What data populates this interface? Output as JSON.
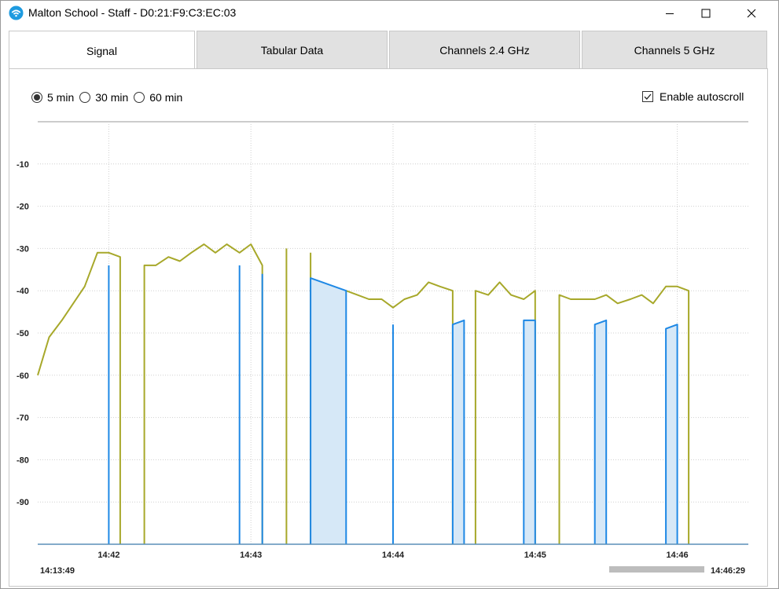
{
  "window": {
    "title": "Malton School - Staff - D0:21:F9:C3:EC:03",
    "icon": "wifi-app-icon",
    "controls": {
      "minimize": "minimize-icon",
      "maximize": "maximize-icon",
      "close": "close-icon"
    }
  },
  "tabs": [
    {
      "label": "Signal",
      "active": true
    },
    {
      "label": "Tabular Data",
      "active": false
    },
    {
      "label": "Channels 2.4 GHz",
      "active": false
    },
    {
      "label": "Channels 5 GHz",
      "active": false
    }
  ],
  "time_range": {
    "options": [
      "5 min",
      "30 min",
      "60 min"
    ],
    "selected": "5 min"
  },
  "autoscroll": {
    "label": "Enable autoscroll",
    "checked": true
  },
  "range": {
    "start": "14:13:49",
    "end": "14:46:29"
  },
  "colors": {
    "olive_series": "#a7a82a",
    "blue_series": "#1e88e5",
    "blue_fill": "#d6e8f7"
  },
  "chart_data": {
    "type": "line",
    "x_unit": "minutes past 14:00",
    "xlim": [
      41.5,
      46.5
    ],
    "ylim": [
      -100,
      0
    ],
    "yticks": [
      -10,
      -20,
      -30,
      -40,
      -50,
      -60,
      -70,
      -80,
      -90
    ],
    "ytick_labels": [
      "-10",
      "-20",
      "-30",
      "-40",
      "-50",
      "-60",
      "-70",
      "-80",
      "-90"
    ],
    "xticks": [
      42,
      43,
      44,
      45,
      46
    ],
    "xtick_labels": [
      "14:42",
      "14:43",
      "14:44",
      "14:45",
      "14:46"
    ],
    "grid": true,
    "series": [
      {
        "color": "#a7a82a",
        "filled": false,
        "segments": [
          [
            [
              41.5,
              -60
            ],
            [
              41.58,
              -51
            ],
            [
              41.67,
              -47
            ],
            [
              41.83,
              -39
            ],
            [
              41.92,
              -31
            ],
            [
              42.0,
              -31
            ],
            [
              42.08,
              -32
            ],
            [
              42.08,
              -100
            ]
          ],
          [
            [
              42.25,
              -100
            ],
            [
              42.25,
              -34
            ],
            [
              42.33,
              -34
            ],
            [
              42.42,
              -32
            ],
            [
              42.5,
              -33
            ],
            [
              42.58,
              -31
            ],
            [
              42.67,
              -29
            ],
            [
              42.75,
              -31
            ],
            [
              42.83,
              -29
            ],
            [
              42.92,
              -31
            ],
            [
              43.0,
              -29
            ],
            [
              43.08,
              -34
            ],
            [
              43.08,
              -100
            ]
          ],
          [
            [
              43.25,
              -100
            ],
            [
              43.25,
              -30
            ]
          ],
          [
            [
              43.42,
              -31
            ],
            [
              43.42,
              -100
            ]
          ],
          [
            [
              43.58,
              -100
            ],
            [
              43.58,
              -41
            ],
            [
              43.67,
              -40
            ],
            [
              43.75,
              -41
            ],
            [
              43.83,
              -42
            ],
            [
              43.92,
              -42
            ],
            [
              44.0,
              -44
            ],
            [
              44.08,
              -42
            ],
            [
              44.17,
              -41
            ],
            [
              44.25,
              -38
            ],
            [
              44.33,
              -39
            ],
            [
              44.42,
              -40
            ],
            [
              44.42,
              -100
            ]
          ],
          [
            [
              44.58,
              -100
            ],
            [
              44.58,
              -40
            ],
            [
              44.67,
              -41
            ],
            [
              44.75,
              -38
            ],
            [
              44.83,
              -41
            ],
            [
              44.92,
              -42
            ],
            [
              45.0,
              -40
            ],
            [
              45.0,
              -100
            ]
          ],
          [
            [
              45.17,
              -100
            ],
            [
              45.17,
              -41
            ],
            [
              45.25,
              -42
            ],
            [
              45.33,
              -42
            ],
            [
              45.42,
              -42
            ],
            [
              45.5,
              -41
            ],
            [
              45.58,
              -43
            ],
            [
              45.67,
              -42
            ],
            [
              45.75,
              -41
            ],
            [
              45.83,
              -43
            ],
            [
              45.92,
              -39
            ],
            [
              46.0,
              -39
            ],
            [
              46.08,
              -40
            ],
            [
              46.08,
              -100
            ]
          ]
        ]
      },
      {
        "color": "#1e88e5",
        "filled": true,
        "segments": [
          [
            [
              42.0,
              -34
            ],
            [
              42.0,
              -100
            ]
          ],
          [
            [
              42.92,
              -34
            ],
            [
              42.92,
              -100
            ]
          ],
          [
            [
              43.08,
              -36
            ],
            [
              43.08,
              -100
            ]
          ],
          [
            [
              43.42,
              -100
            ],
            [
              43.42,
              -37
            ],
            [
              43.67,
              -40
            ],
            [
              43.67,
              -100
            ]
          ],
          [
            [
              44.0,
              -48
            ],
            [
              44.0,
              -100
            ]
          ],
          [
            [
              44.42,
              -100
            ],
            [
              44.42,
              -48
            ],
            [
              44.5,
              -47
            ],
            [
              44.5,
              -100
            ]
          ],
          [
            [
              44.92,
              -100
            ],
            [
              44.92,
              -47
            ],
            [
              45.0,
              -47
            ],
            [
              45.0,
              -100
            ]
          ],
          [
            [
              45.42,
              -100
            ],
            [
              45.42,
              -48
            ],
            [
              45.5,
              -47
            ],
            [
              45.5,
              -100
            ]
          ],
          [
            [
              45.92,
              -100
            ],
            [
              45.92,
              -49
            ],
            [
              46.0,
              -48
            ],
            [
              46.0,
              -100
            ]
          ]
        ]
      }
    ]
  }
}
